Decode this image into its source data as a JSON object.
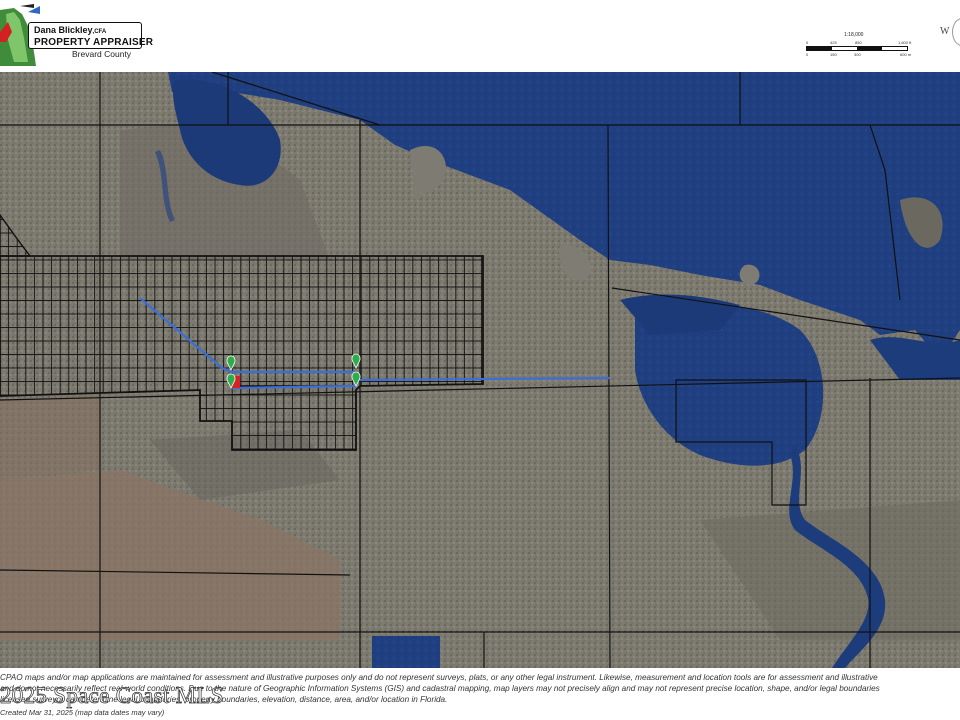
{
  "header": {
    "appraiser_name": "Dana Blickley",
    "appraiser_suffix": ",CFA",
    "office_title": "PROPERTY APPRAISER",
    "county": "Brevard County",
    "compass_letter": "W"
  },
  "scale_bar": {
    "ratio": "1:18,000",
    "top_ticks": [
      "0",
      "425",
      "850",
      "1,700",
      "1,600 ft"
    ],
    "bottom_ticks": [
      "0",
      "150",
      "300",
      "600 m"
    ]
  },
  "map": {
    "water_color": "#1c3a78",
    "land_color": "#7b786f",
    "parcel_line_color": "#111111",
    "route_line_color": "#3b6fd6",
    "marker_color": "#2eab4a",
    "selected_parcel_color": "#d62222"
  },
  "disclaimer": {
    "line1": "CPAO maps and/or map applications are maintained for assessment and illustrative purposes only and do not represent surveys, plats, or any other legal instrument. Likewise, measurement and location tools are for assessment and illustrative",
    "line2": "and do not necessarily reflect real-world conditions. Due to the nature of Geographic Information Systems (GIS) and cadastral mapping, map layers may not precisely align and may not represent precise location, shape, and/or legal boundaries",
    "line3": "licensed surveyor can determine legal boundaries, property boundaries, elevation, distance, area, and/or location in Florida.",
    "line4": "Created Mar 31, 2025 (map data dates may vary)"
  },
  "watermark": "2025 Space Coast MLS"
}
